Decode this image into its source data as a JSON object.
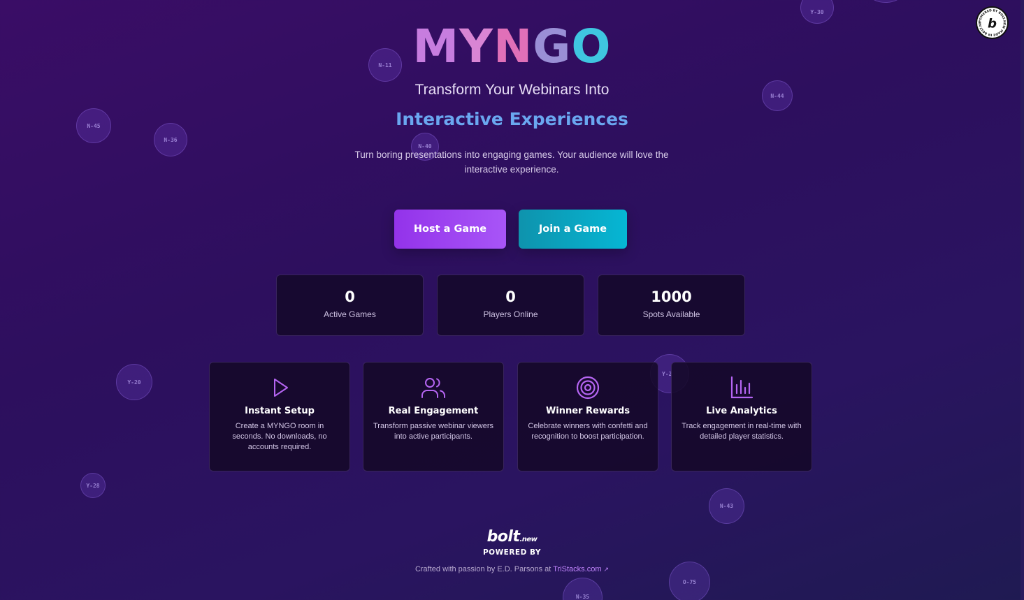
{
  "hero": {
    "logo_letters": [
      "M",
      "Y",
      "N",
      "G",
      "O"
    ],
    "subtitle": "Transform Your Webinars Into",
    "highlight": "Interactive Experiences",
    "description": "Turn boring presentations into engaging games. Your audience will love the interactive experience."
  },
  "actions": {
    "host_label": "Host a Game",
    "join_label": "Join a Game"
  },
  "stats": [
    {
      "value": "0",
      "label": "Active Games"
    },
    {
      "value": "0",
      "label": "Players Online"
    },
    {
      "value": "1000",
      "label": "Spots Available"
    }
  ],
  "features": [
    {
      "icon": "play-icon",
      "title": "Instant Setup",
      "description": "Create a MYNGO room in seconds. No downloads, no accounts required."
    },
    {
      "icon": "users-icon",
      "title": "Real Engagement",
      "description": "Transform passive webinar viewers into active participants."
    },
    {
      "icon": "target-icon",
      "title": "Winner Rewards",
      "description": "Celebrate winners with confetti and recognition to boost participation."
    },
    {
      "icon": "bar-chart-icon",
      "title": "Live Analytics",
      "description": "Track engagement in real-time with detailed player statistics."
    }
  ],
  "background_balls": [
    "N-11",
    "N-45",
    "N-36",
    "N-40",
    "Y-30",
    "N-44",
    "Y-20",
    "Y-2",
    "Y-28",
    "N-43",
    "O-75",
    "N-35"
  ],
  "footer": {
    "brand": "bolt",
    "brand_suffix": ".new",
    "powered_by": "POWERED BY",
    "credit_prefix": "Crafted with passion by E.D. Parsons at",
    "credit_link": "TriStacks.com"
  },
  "badge": {
    "letter": "b",
    "ring_text": "POWERED BY BOLT.NEW MADE IN BOLT.NEW"
  },
  "colors": {
    "host_button": "#9333ea",
    "join_button": "#06b6d4",
    "accent_link": "#c084fc"
  }
}
